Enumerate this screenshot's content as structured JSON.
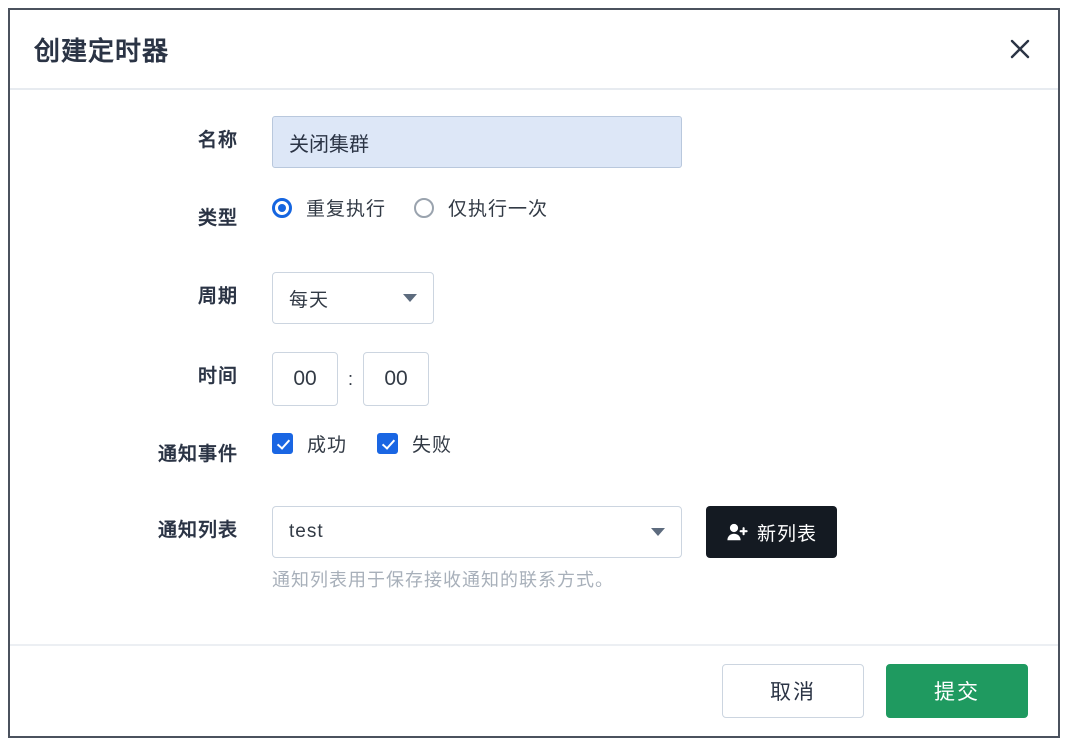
{
  "dialog": {
    "title": "创建定时器",
    "close_icon": "close-icon"
  },
  "form": {
    "name": {
      "label": "名称",
      "value": "关闭集群",
      "placeholder": ""
    },
    "type": {
      "label": "类型",
      "options": [
        {
          "label": "重复执行",
          "selected": true
        },
        {
          "label": "仅执行一次",
          "selected": false
        }
      ]
    },
    "period": {
      "label": "周期",
      "value": "每天",
      "arrow_icon": "chevron-down-icon"
    },
    "time": {
      "label": "时间",
      "hour": "00",
      "minute": "00",
      "separator": ":"
    },
    "events": {
      "label": "通知事件",
      "options": [
        {
          "label": "成功",
          "checked": true
        },
        {
          "label": "失败",
          "checked": true
        }
      ]
    },
    "list": {
      "label": "通知列表",
      "value": "test",
      "arrow_icon": "chevron-down-icon",
      "new_button_label": "新列表",
      "new_button_icon": "user-add-icon",
      "hint": "通知列表用于保存接收通知的联系方式。"
    }
  },
  "footer": {
    "cancel_label": "取消",
    "submit_label": "提交"
  },
  "colors": {
    "accent_blue": "#1565e0",
    "submit_green": "#1f9a60",
    "dark_button": "#141a22",
    "name_field_bg": "#dde7f7"
  }
}
